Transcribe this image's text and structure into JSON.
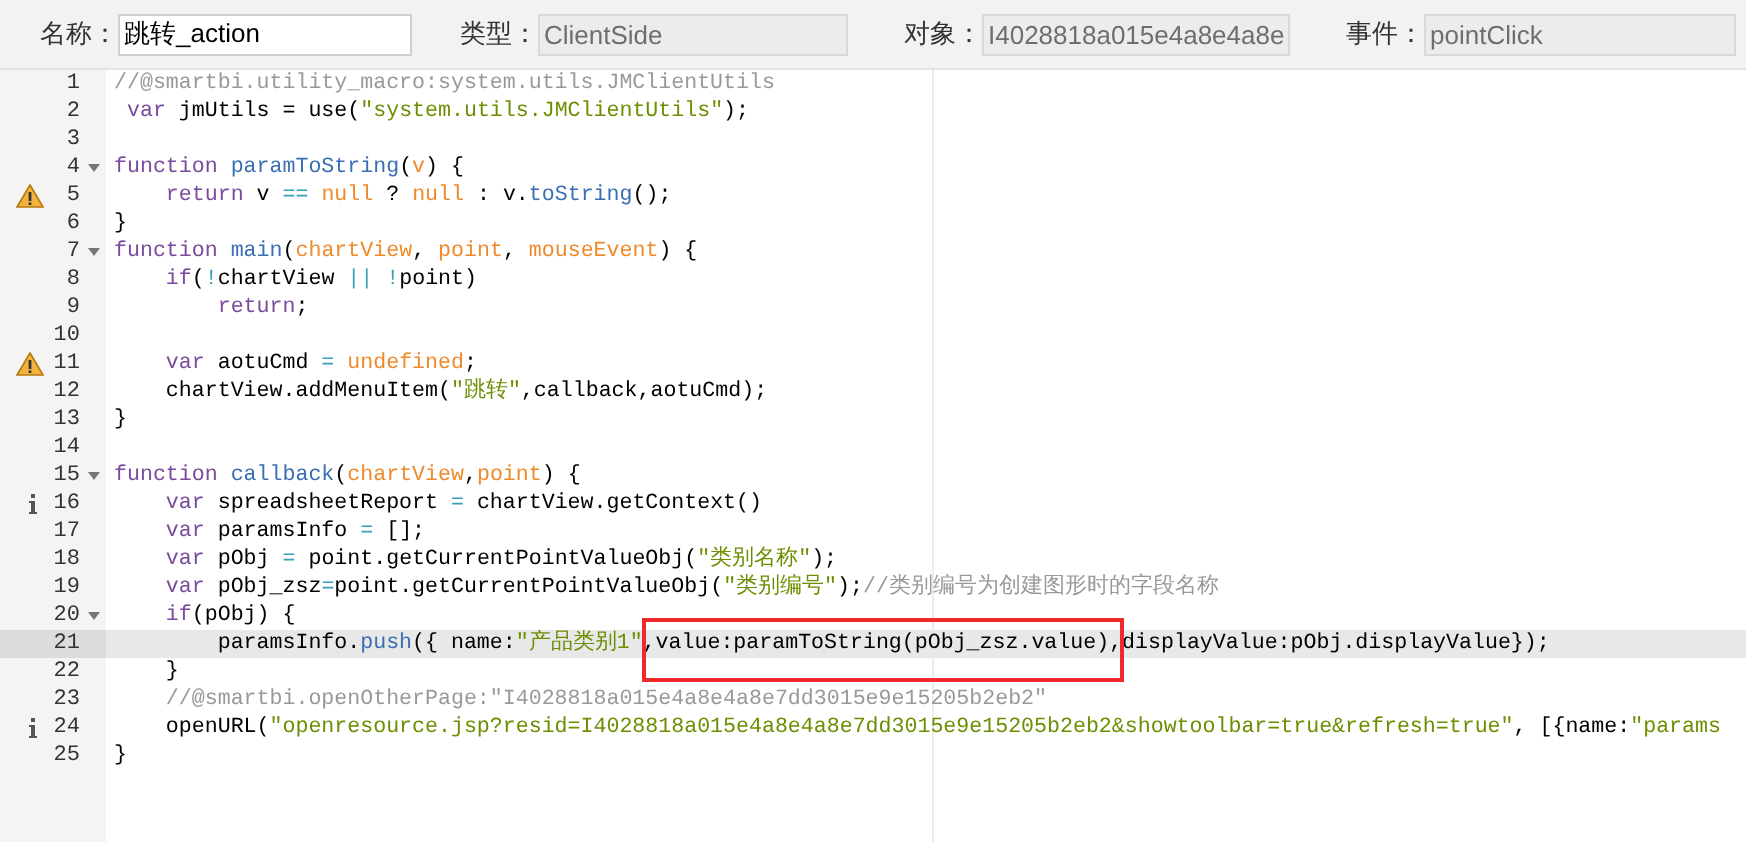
{
  "fields": [
    {
      "label": "名称：",
      "value": "跳转_action",
      "disabled": false
    },
    {
      "label": "类型：",
      "value": "ClientSide",
      "disabled": true
    },
    {
      "label": "对象：",
      "value": "I4028818a015e4a8e4a8e",
      "disabled": true
    },
    {
      "label": "事件：",
      "value": "pointClick",
      "disabled": true
    }
  ],
  "lines": [
    {
      "number": "1",
      "tokens": [
        {
          "kind": "comment",
          "text": "//@smartbi.utility_macro:system.utils.JMClientUtils"
        }
      ]
    },
    {
      "number": "2",
      "tokens": [
        {
          "kind": "keyword",
          "text": " var"
        },
        {
          "kind": "plain",
          "text": " jmUtils = use("
        },
        {
          "kind": "string",
          "text": "\"system.utils.JMClientUtils\""
        },
        {
          "kind": "plain",
          "text": ");"
        }
      ]
    },
    {
      "number": "3"
    },
    {
      "number": "4",
      "foldable": true,
      "tokens": [
        {
          "kind": "keyword",
          "text": "function"
        },
        {
          "kind": "function",
          "text": " paramToString"
        },
        {
          "kind": "plain",
          "text": "("
        },
        {
          "kind": "param",
          "text": "v"
        },
        {
          "kind": "plain",
          "text": ") {"
        }
      ]
    },
    {
      "number": "5",
      "marker": {
        "kind": "warning"
      },
      "tokens": [
        {
          "kind": "keyword",
          "text": "    return"
        },
        {
          "kind": "plain",
          "text": " v"
        },
        {
          "kind": "operator",
          "text": " =="
        },
        {
          "kind": "constant",
          "text": " null"
        },
        {
          "kind": "plain",
          "text": " ?"
        },
        {
          "kind": "constant",
          "text": " null"
        },
        {
          "kind": "plain",
          "text": " : v."
        },
        {
          "kind": "method",
          "text": "toString"
        },
        {
          "kind": "plain",
          "text": "();"
        }
      ]
    },
    {
      "number": "6",
      "tokens": [
        {
          "kind": "plain",
          "text": "}"
        }
      ]
    },
    {
      "number": "7",
      "foldable": true,
      "tokens": [
        {
          "kind": "keyword",
          "text": "function"
        },
        {
          "kind": "function",
          "text": " main"
        },
        {
          "kind": "plain",
          "text": "("
        },
        {
          "kind": "param",
          "text": "chartView"
        },
        {
          "kind": "plain",
          "text": ","
        },
        {
          "kind": "param",
          "text": " point"
        },
        {
          "kind": "plain",
          "text": ","
        },
        {
          "kind": "param",
          "text": " mouseEvent"
        },
        {
          "kind": "plain",
          "text": ") {"
        }
      ]
    },
    {
      "number": "8",
      "tokens": [
        {
          "kind": "keyword",
          "text": "    if"
        },
        {
          "kind": "plain",
          "text": "("
        },
        {
          "kind": "operator",
          "text": "!"
        },
        {
          "kind": "plain",
          "text": "chartView"
        },
        {
          "kind": "operator",
          "text": " ||"
        },
        {
          "kind": "operator",
          "text": " !"
        },
        {
          "kind": "plain",
          "text": "point)"
        }
      ]
    },
    {
      "number": "9",
      "tokens": [
        {
          "kind": "keyword",
          "text": "        return"
        },
        {
          "kind": "plain",
          "text": ";"
        }
      ]
    },
    {
      "number": "10"
    },
    {
      "number": "11",
      "marker": {
        "kind": "warning"
      },
      "tokens": [
        {
          "kind": "keyword",
          "text": "    var"
        },
        {
          "kind": "plain",
          "text": " aotuCmd"
        },
        {
          "kind": "operator",
          "text": " ="
        },
        {
          "kind": "constant",
          "text": " undefined"
        },
        {
          "kind": "plain",
          "text": ";"
        }
      ]
    },
    {
      "number": "12",
      "tokens": [
        {
          "kind": "plain",
          "text": "    chartView.addMenuItem("
        },
        {
          "kind": "string",
          "text": "\"跳转\""
        },
        {
          "kind": "plain",
          "text": ",callback,aotuCmd);"
        }
      ]
    },
    {
      "number": "13",
      "tokens": [
        {
          "kind": "plain",
          "text": "}"
        }
      ]
    },
    {
      "number": "14"
    },
    {
      "number": "15",
      "foldable": true,
      "tokens": [
        {
          "kind": "keyword",
          "text": "function"
        },
        {
          "kind": "function",
          "text": " callback"
        },
        {
          "kind": "plain",
          "text": "("
        },
        {
          "kind": "param",
          "text": "chartView"
        },
        {
          "kind": "plain",
          "text": ","
        },
        {
          "kind": "param",
          "text": "point"
        },
        {
          "kind": "plain",
          "text": ") {"
        }
      ]
    },
    {
      "number": "16",
      "marker": {
        "kind": "info"
      },
      "tokens": [
        {
          "kind": "keyword",
          "text": "    var"
        },
        {
          "kind": "plain",
          "text": " spreadsheetReport"
        },
        {
          "kind": "operator",
          "text": " ="
        },
        {
          "kind": "plain",
          "text": " chartView.getContext()"
        }
      ]
    },
    {
      "number": "17",
      "tokens": [
        {
          "kind": "keyword",
          "text": "    var"
        },
        {
          "kind": "plain",
          "text": " paramsInfo"
        },
        {
          "kind": "operator",
          "text": " ="
        },
        {
          "kind": "plain",
          "text": " [];"
        }
      ]
    },
    {
      "number": "18",
      "tokens": [
        {
          "kind": "keyword",
          "text": "    var"
        },
        {
          "kind": "plain",
          "text": " pObj"
        },
        {
          "kind": "operator",
          "text": " ="
        },
        {
          "kind": "plain",
          "text": " point.getCurrentPointValueObj("
        },
        {
          "kind": "string",
          "text": "\"类别名称\""
        },
        {
          "kind": "plain",
          "text": ");"
        }
      ]
    },
    {
      "number": "19",
      "tokens": [
        {
          "kind": "keyword",
          "text": "    var"
        },
        {
          "kind": "plain",
          "text": " pObj_zsz"
        },
        {
          "kind": "operator",
          "text": "="
        },
        {
          "kind": "plain",
          "text": "point.getCurrentPointValueObj("
        },
        {
          "kind": "string",
          "text": "\"类别编号\""
        },
        {
          "kind": "plain",
          "text": ");"
        },
        {
          "kind": "comment",
          "text": "//类别编号为创建图形时的字段名称"
        }
      ]
    },
    {
      "number": "20",
      "foldable": true,
      "tokens": [
        {
          "kind": "keyword",
          "text": "    if"
        },
        {
          "kind": "plain",
          "text": "(pObj) {"
        }
      ]
    },
    {
      "number": "21",
      "active": true,
      "boxed": true,
      "tokens": [
        {
          "kind": "plain",
          "text": "        paramsInfo."
        },
        {
          "kind": "method",
          "text": "push"
        },
        {
          "kind": "plain",
          "text": "({ name:"
        },
        {
          "kind": "string",
          "text": "\"产品类别1\""
        },
        {
          "kind": "plain",
          "text": ",value:paramToString(pObj_zsz.value),displayValue:pObj.displayValue});"
        }
      ]
    },
    {
      "number": "22",
      "tokens": [
        {
          "kind": "plain",
          "text": "    }"
        }
      ]
    },
    {
      "number": "23",
      "tokens": [
        {
          "kind": "comment",
          "text": "    //@smartbi.openOtherPage:\"I4028818a015e4a8e4a8e7dd3015e9e15205b2eb2\""
        }
      ]
    },
    {
      "number": "24",
      "marker": {
        "kind": "info"
      },
      "tokens": [
        {
          "kind": "plain",
          "text": "    openURL("
        },
        {
          "kind": "string",
          "text": "\"openresource.jsp?resid=I4028818a015e4a8e4a8e7dd3015e9e15205b2eb2&showtoolbar=true&refresh=true\""
        },
        {
          "kind": "plain",
          "text": ", [{name:"
        },
        {
          "kind": "string",
          "text": "\"params"
        }
      ]
    },
    {
      "number": "25",
      "tokens": [
        {
          "kind": "plain",
          "text": "}"
        }
      ]
    }
  ]
}
